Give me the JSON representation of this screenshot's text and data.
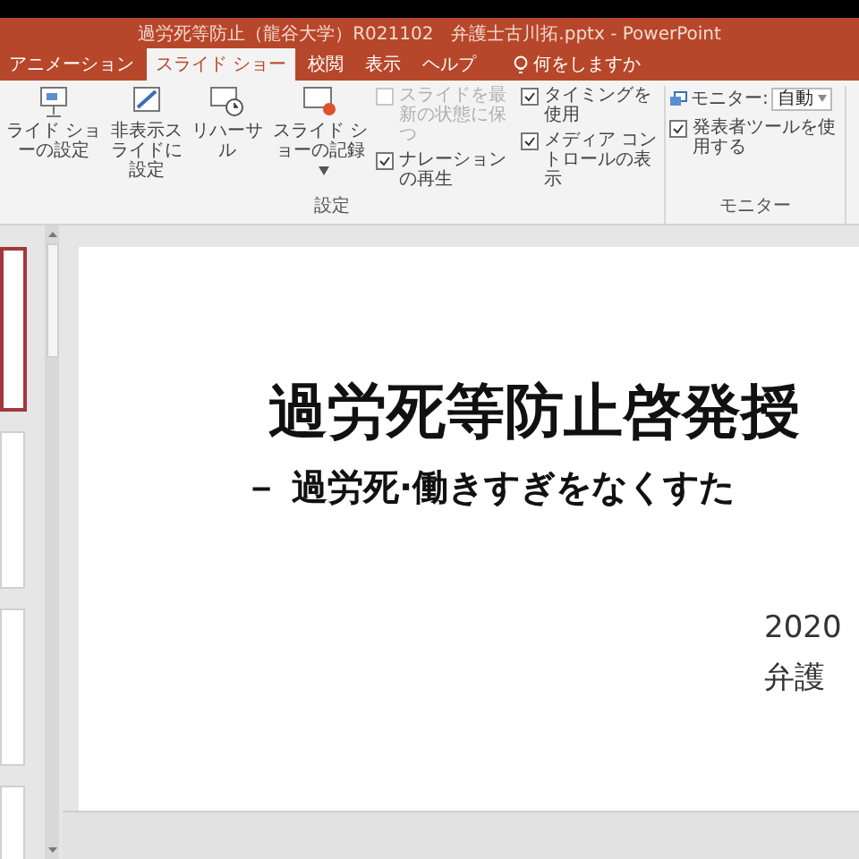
{
  "window": {
    "title": "過労死等防止（龍谷大学）R021102　弁護士古川拓.pptx - PowerPoint"
  },
  "tabs": [
    {
      "label": "アニメーション",
      "selected": false
    },
    {
      "label": "スライド ショー",
      "selected": true
    },
    {
      "label": "校閲",
      "selected": false
    },
    {
      "label": "表示",
      "selected": false
    },
    {
      "label": "ヘルプ",
      "selected": false
    }
  ],
  "tell_me": {
    "label": "何をしますか"
  },
  "ribbon": {
    "settings": {
      "label": "設定",
      "buttons": [
        {
          "kind": "setup",
          "label": "ライド ショーの設定",
          "dropdown": false
        },
        {
          "kind": "hide",
          "label": "非表示スライドに設定",
          "dropdown": false
        },
        {
          "kind": "rehearse",
          "label": "リハーサル",
          "dropdown": false
        },
        {
          "kind": "record",
          "label": "スライド ショーの記録",
          "dropdown": true
        }
      ],
      "checkbox_columns": [
        [
          {
            "label": "スライドを最新の状態に保つ",
            "checked": false,
            "disabled": true
          },
          {
            "label": "ナレーションの再生",
            "checked": true,
            "disabled": false
          }
        ],
        [
          {
            "label": "タイミングを使用",
            "checked": true,
            "disabled": false
          },
          {
            "label": "メディア コントロールの表示",
            "checked": true,
            "disabled": false
          }
        ]
      ]
    },
    "monitors": {
      "label": "モニター",
      "monitor_label": "モニター:",
      "monitor_value": "自動",
      "checkboxes": [
        {
          "label": "発表者ツールを使用する",
          "checked": true,
          "disabled": false
        }
      ]
    }
  },
  "thumbnails": [
    {
      "selected": true
    },
    {
      "selected": false
    },
    {
      "selected": false
    },
    {
      "selected": false
    }
  ],
  "slide": {
    "title": "過労死等防止啓発授",
    "subtitle": "－ 過労死·働きすぎをなくすた",
    "details": [
      "2020",
      "弁護"
    ]
  }
}
